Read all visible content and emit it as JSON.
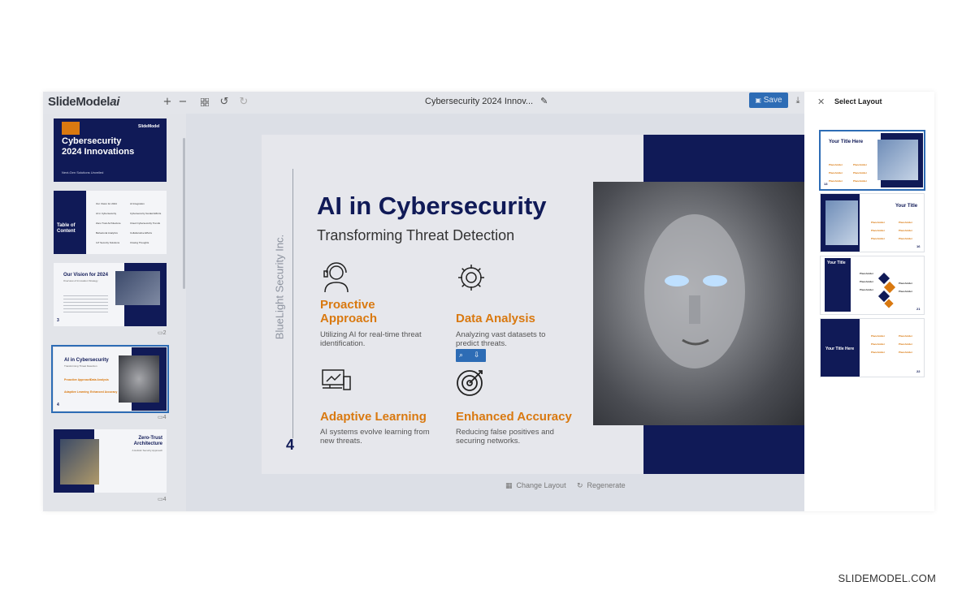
{
  "app": {
    "logo_main": "SlideModel",
    "logo_ai": "ai",
    "document_title": "Cybersecurity 2024 Innov...",
    "save_label": "Save"
  },
  "toolbar_icons": [
    "plus-icon",
    "minus-icon",
    "grid-icon",
    "undo-icon",
    "redo-icon",
    "edit-icon",
    "download-icon"
  ],
  "slides_panel": [
    {
      "number": "",
      "title": "Cybersecurity 2024 Innovations",
      "subtitle": "Next-Gen Solutions Unveiled"
    },
    {
      "number": "",
      "title": "Table of Content",
      "items": [
        "Our Vision for 2024",
        "AI in Cybersecurity",
        "Zero-Trust Architecture",
        "Behavioral Analytics",
        "IoT Security Solutions",
        "AI Integration",
        "Cybersecurity Guided Efforts",
        "Cloud Cybersecurity Trends",
        "Collaborative Efforts",
        "Closing Thoughts"
      ]
    },
    {
      "number": "3",
      "title": "Our Vision for 2024",
      "subtitle": "Overview of Innovation Strategy"
    },
    {
      "number": "4",
      "title": "AI in Cybersecurity",
      "subtitle": "Transforming Threat Detection"
    },
    {
      "number": "",
      "title": "Zero-Trust Architecture",
      "subtitle": "A Holistic Security Approach"
    }
  ],
  "slide": {
    "vertical_text": "BlueLight Security Inc.",
    "page_number": "4",
    "title": "AI in Cybersecurity",
    "subtitle": "Transforming Threat Detection",
    "features": [
      {
        "heading": "Proactive Approach",
        "description": "Utilizing AI for real-time threat identification.",
        "icon": "headset-user-icon"
      },
      {
        "heading": "Data Analysis",
        "description": "Analyzing vast datasets to predict threats.",
        "icon": "gear-icon"
      },
      {
        "heading": "Adaptive Learning",
        "description": "AI systems evolve learning from new threats.",
        "icon": "devices-chart-icon"
      },
      {
        "heading": "Enhanced Accuracy",
        "description": "Reducing false positives and securing networks.",
        "icon": "target-icon"
      }
    ]
  },
  "bottom_actions": {
    "change_layout": "Change Layout",
    "regenerate": "Regenerate"
  },
  "layout_panel": {
    "title": "Select Layout",
    "layouts": [
      {
        "title": "Your Title Here",
        "number": "13",
        "placeholder": "Placeholder"
      },
      {
        "title": "Your Title",
        "number": "16",
        "placeholder": "Placeholder"
      },
      {
        "title": "Your Title",
        "number": "21",
        "placeholder": "Placeholder"
      },
      {
        "title": "Your Title Here",
        "number": "22",
        "placeholder": "Placeholder"
      }
    ]
  },
  "footer": {
    "brand": "SLIDEMODEL.COM"
  },
  "colors": {
    "navy": "#101a57",
    "orange": "#d97910",
    "accent_blue": "#2d6cb5"
  }
}
